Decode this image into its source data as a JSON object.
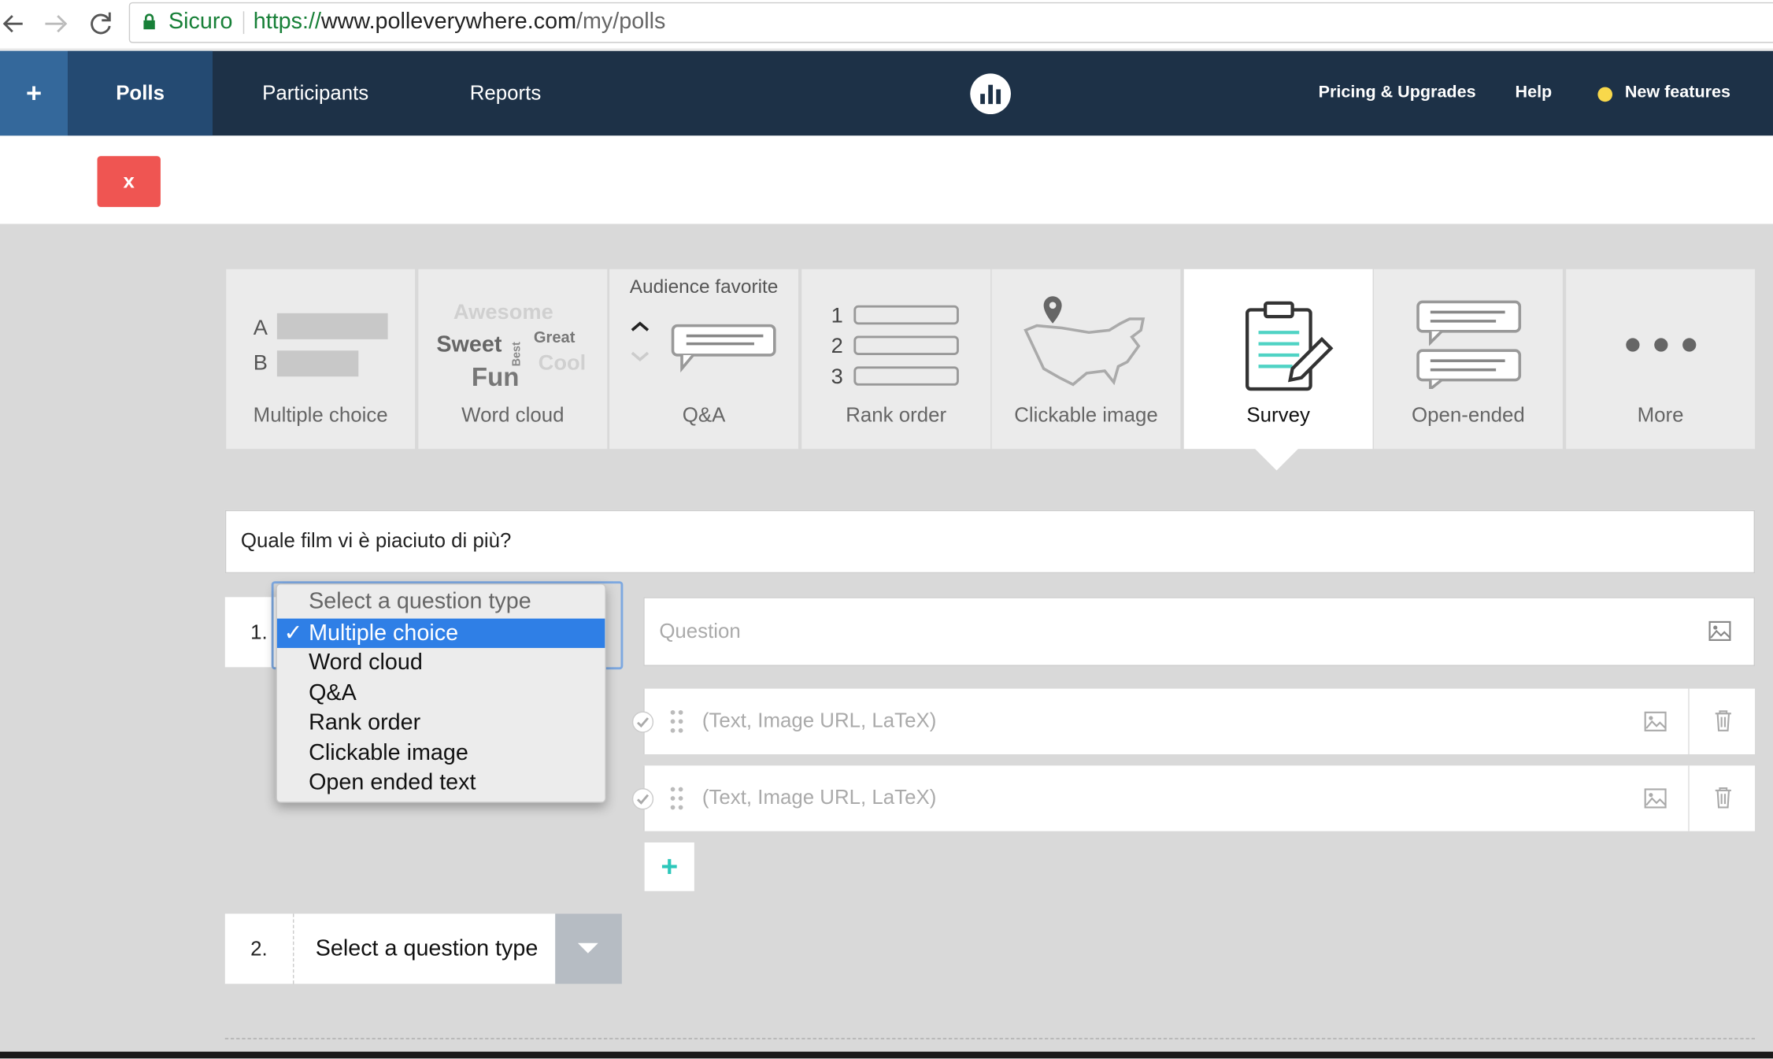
{
  "browser": {
    "secure_label": "Sicuro",
    "url_scheme": "https://",
    "url_host": "www.polleverywhere.com",
    "url_path": "/my/polls"
  },
  "nav": {
    "add_symbol": "+",
    "tabs": [
      "Polls",
      "Participants",
      "Reports"
    ],
    "active_tab": "Polls",
    "right_links": [
      "Pricing & Upgrades",
      "Help",
      "New features"
    ]
  },
  "toolbar": {
    "close_label": "x"
  },
  "poll_types": {
    "tiles": [
      {
        "label": "Multiple choice",
        "icon": "multiple-choice-icon",
        "letters": [
          "A",
          "B"
        ]
      },
      {
        "label": "Word cloud",
        "icon": "word-cloud-icon",
        "words": [
          "Awesome",
          "Sweet",
          "Best",
          "Great",
          "Fun",
          "Cool"
        ]
      },
      {
        "label": "Q&A",
        "icon": "qa-icon",
        "header": "Audience favorite"
      },
      {
        "label": "Rank order",
        "icon": "rank-order-icon",
        "numbers": [
          "1",
          "2",
          "3"
        ]
      },
      {
        "label": "Clickable image",
        "icon": "clickable-image-icon"
      },
      {
        "label": "Survey",
        "icon": "survey-icon"
      },
      {
        "label": "Open-ended",
        "icon": "open-ended-icon"
      },
      {
        "label": "More",
        "icon": "more-icon"
      }
    ],
    "active": "Survey"
  },
  "survey": {
    "title": "Quale film vi è piaciuto di più?",
    "q1": {
      "number": "1.",
      "question_placeholder": "Question",
      "option_placeholder": "(Text, Image URL, LaTeX)",
      "dropdown": {
        "placeholder": "Select a question type",
        "options": [
          "Multiple choice",
          "Word cloud",
          "Q&A",
          "Rank order",
          "Clickable image",
          "Open ended text"
        ],
        "selected": "Multiple choice"
      }
    },
    "add_symbol": "+",
    "q2": {
      "number": "2.",
      "select_label": "Select a question type"
    }
  },
  "colors": {
    "nav_bg": "#1d3147",
    "active_tab": "#244a72",
    "close_red": "#ef5552",
    "accent_teal": "#2cc7ba",
    "highlight_blue": "#2f7fe6"
  }
}
